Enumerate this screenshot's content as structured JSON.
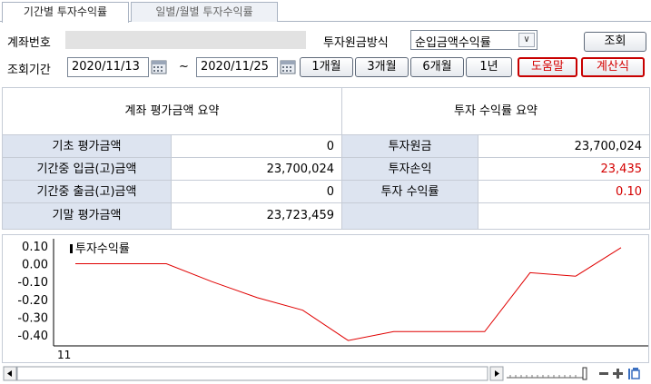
{
  "tabs": [
    {
      "label": "기간별 투자수익률",
      "active": true
    },
    {
      "label": "일별/월별 투자수익률",
      "active": false
    }
  ],
  "account": {
    "label": "계좌번호",
    "value": ""
  },
  "method": {
    "label": "투자원금방식",
    "selected": "순입금액수익률"
  },
  "buttons": {
    "search": "조회",
    "m1": "1개월",
    "m3": "3개월",
    "m6": "6개월",
    "y1": "1년",
    "help": "도움말",
    "formula": "계산식"
  },
  "period": {
    "label": "조회기간",
    "start": "2020/11/13",
    "separator": "~",
    "end": "2020/11/25"
  },
  "summary": {
    "left_title": "계좌 평가금액 요약",
    "right_title": "투자 수익률 요약",
    "left_rows": [
      {
        "label": "기초 평가금액",
        "value": "0"
      },
      {
        "label": "기간중 입금(고)금액",
        "value": "23,700,024"
      },
      {
        "label": "기간중 출금(고)금액",
        "value": "0"
      },
      {
        "label": "기말 평가금액",
        "value": "23,723,459"
      }
    ],
    "right_rows": [
      {
        "label": "투자원금",
        "value": "23,700,024"
      },
      {
        "label": "투자손익",
        "value": "23,435"
      },
      {
        "label": "투자 수익률",
        "value": "0.10"
      },
      {
        "label": "",
        "value": ""
      }
    ],
    "negative_color": "#d40000"
  },
  "chart_data": {
    "type": "line",
    "series": [
      {
        "name": "투자수익률",
        "values": [
          0.0,
          0.0,
          0.0,
          -0.1,
          -0.19,
          -0.26,
          -0.43,
          -0.38,
          -0.38,
          -0.38,
          -0.05,
          -0.07,
          0.09
        ]
      }
    ],
    "y_ticks": [
      "0.10",
      "0.00",
      "-0.10",
      "-0.20",
      "-0.30",
      "-0.40"
    ],
    "y_tick_values": [
      0.1,
      0.0,
      -0.1,
      -0.2,
      -0.3,
      -0.4
    ],
    "ylim": [
      -0.46,
      0.14
    ],
    "x_label": "11",
    "line_color": "#e00000"
  },
  "icons": {
    "calendar": "calendar-icon",
    "scroll_left": "arrow-left-icon",
    "scroll_right": "arrow-right-icon",
    "zoom_out": "minus-icon",
    "zoom_in": "plus-icon",
    "settings": "chart-settings-icon"
  }
}
